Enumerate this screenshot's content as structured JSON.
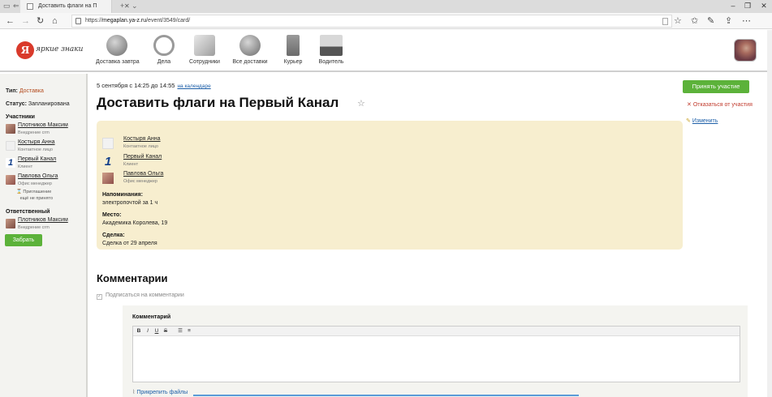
{
  "browser": {
    "tab_title": "Доставить флаги на Пе",
    "url_prefix": "https://",
    "url_domain": "megaplan.ya-z.ru",
    "url_path": "/event/3549/card/"
  },
  "header": {
    "logo_letter": "Я",
    "logo_text": "яркие знаки",
    "nav": [
      {
        "label": "Доставка завтра",
        "icon": "globe-icon"
      },
      {
        "label": "Дела",
        "icon": "clock-icon"
      },
      {
        "label": "Сотрудники",
        "icon": "cards-icon"
      },
      {
        "label": "Все доставки",
        "icon": "globe-icon"
      },
      {
        "label": "Курьер",
        "icon": "hand-truck-icon"
      },
      {
        "label": "Водитель",
        "icon": "truck-icon"
      }
    ]
  },
  "sidebar": {
    "type_label": "Тип:",
    "type_value": "Доставка",
    "status_label": "Статус:",
    "status_value": "Запланирована",
    "participants_heading": "Участники",
    "participants": [
      {
        "name": "Плотников Максим",
        "role": "Внедрение crm"
      },
      {
        "name": "Костыря Анна",
        "role": "Контактное лицо"
      },
      {
        "name": "Первый Канал",
        "role": "Клиент"
      },
      {
        "name": "Павлова Ольга",
        "role": "Офис менеджер"
      }
    ],
    "invite_note_1": "Приглашение",
    "invite_note_2": "ещё не принято",
    "responsible_heading": "Ответственный",
    "responsible": {
      "name": "Плотников Максим",
      "role": "Внедрение crm"
    },
    "take_button": "Забрать"
  },
  "main": {
    "date_text": "5 сентября с 14:25 до 14:55",
    "calendar_link": "на календаре",
    "title": "Доставить флаги на Первый Канал",
    "card": {
      "people": [
        {
          "name": "Костыря Анна",
          "role": "Контактное лицо"
        },
        {
          "name": "Первый Канал",
          "role": "Клиент"
        },
        {
          "name": "Павлова Ольга",
          "role": "Офис менеджер"
        }
      ],
      "reminder_label": "Напоминания:",
      "reminder_value": "электропочтой за 1 ч",
      "place_label": "Место:",
      "place_value": "Академика Королева, 19",
      "deal_label": "Сделка:",
      "deal_value": "Сделка от 29 апреля"
    },
    "accept_button": "Принять участие",
    "decline_link": "Отказаться от участия",
    "edit_link": "Изменить",
    "comments_heading": "Комментарии",
    "subscribe_label": "Подписаться на комментарии",
    "comment_label": "Комментарий",
    "toolbar": {
      "bold": "B",
      "italic": "I",
      "underline": "U",
      "strike": "S"
    },
    "attach_link": "Прикрепить файлы"
  }
}
